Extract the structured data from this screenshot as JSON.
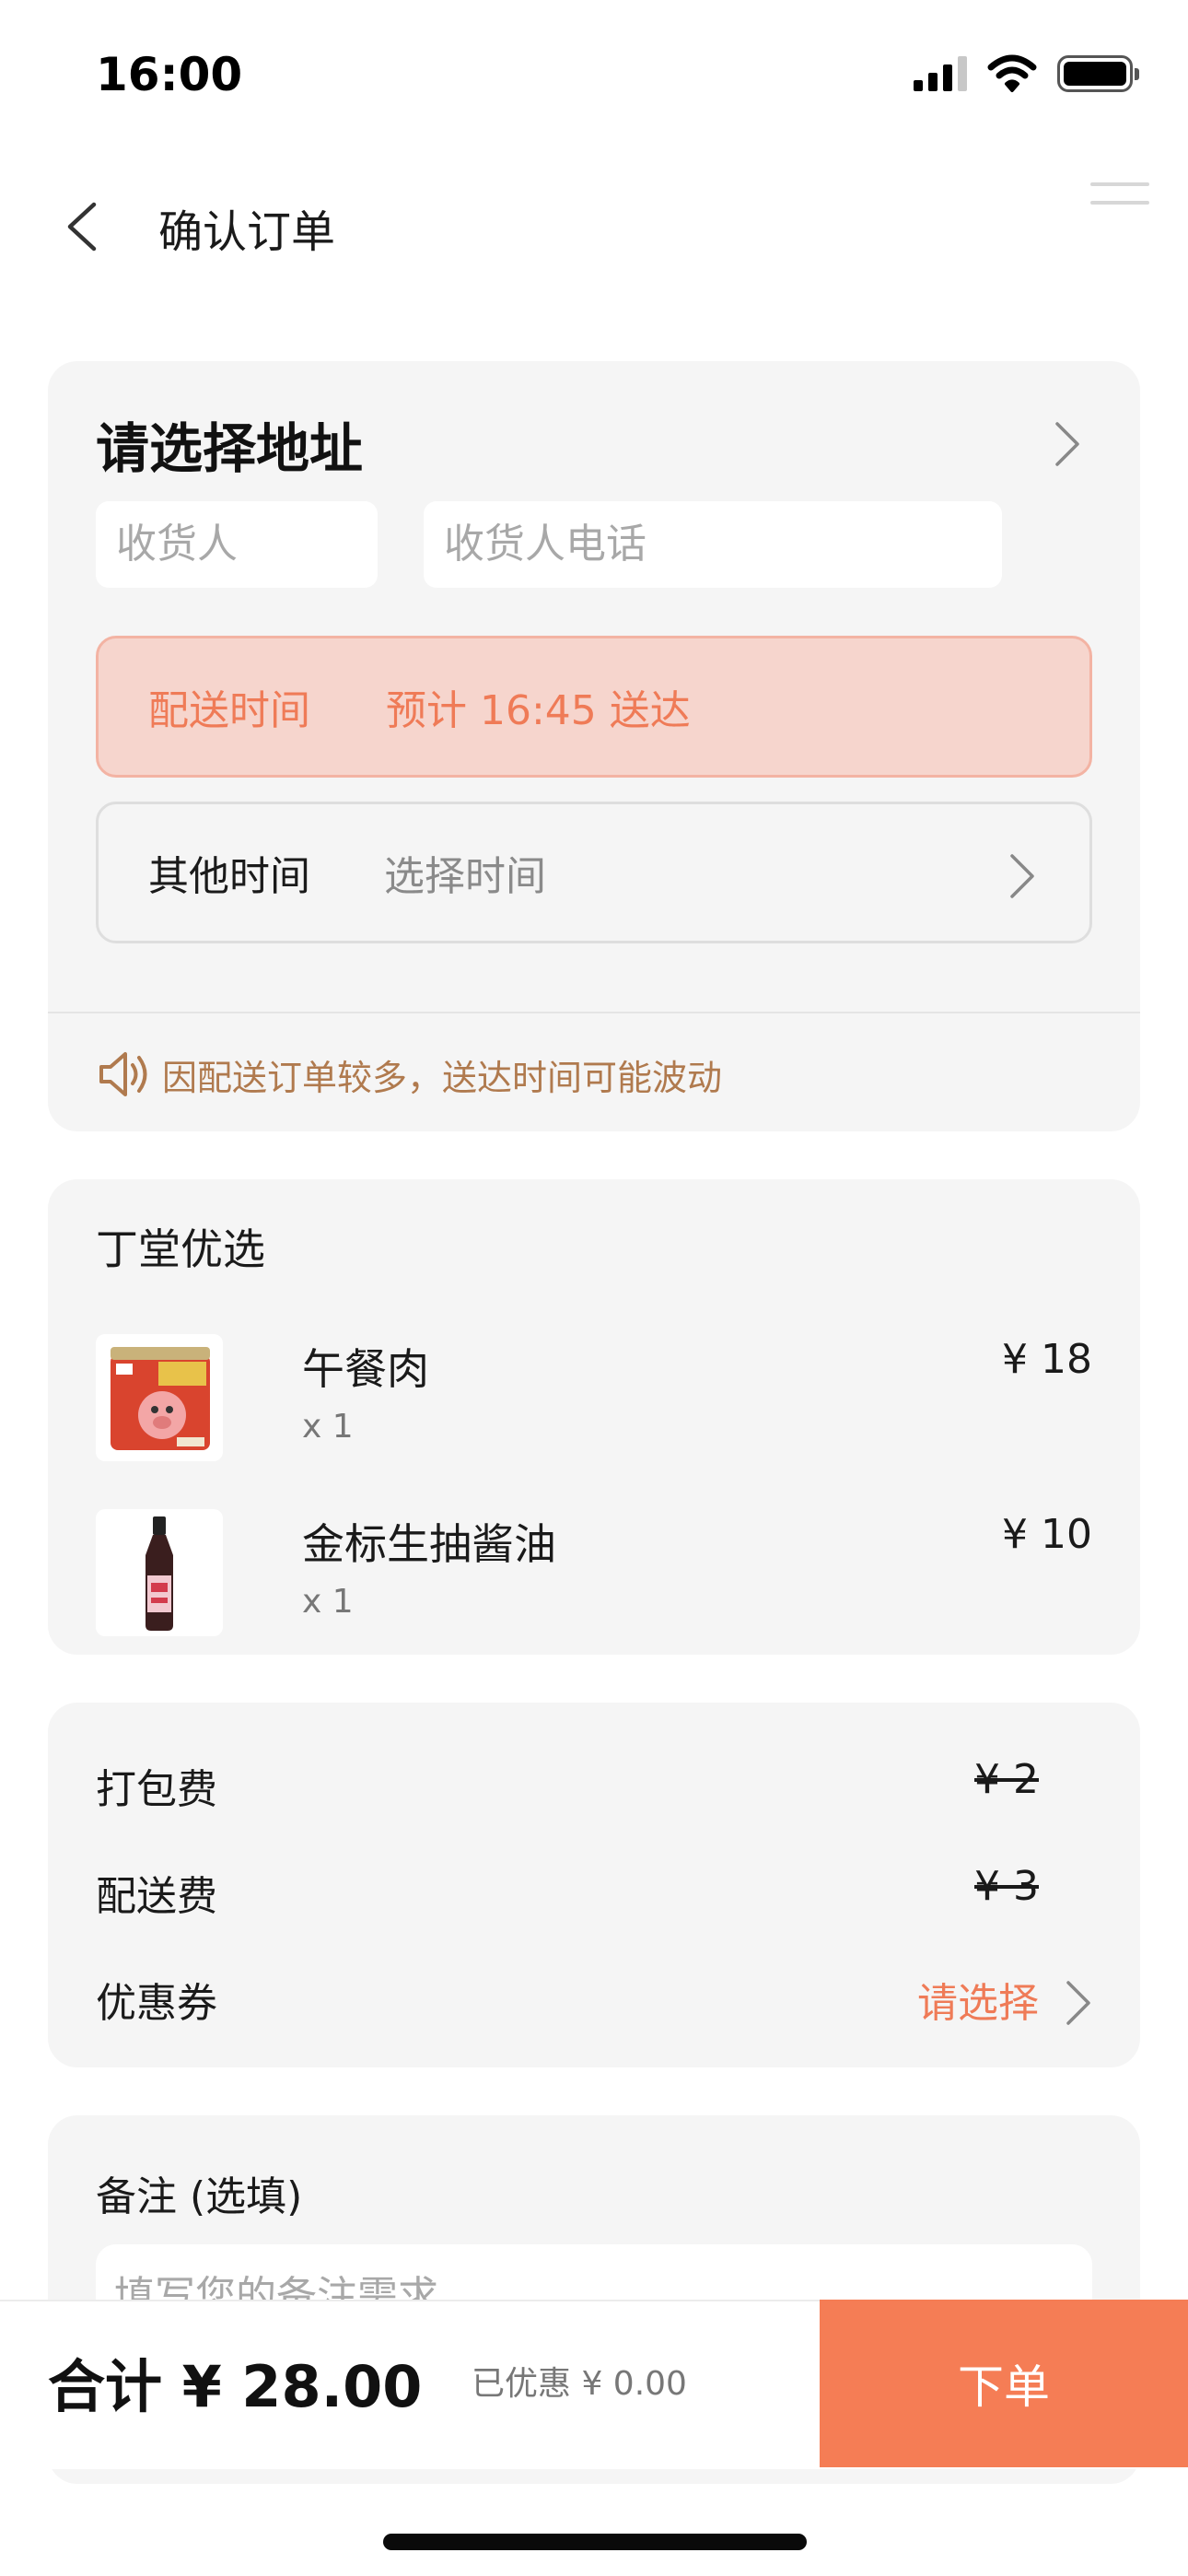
{
  "status_bar": {
    "time": "16:00"
  },
  "nav": {
    "title": "确认订单"
  },
  "address": {
    "title": "请选择地址",
    "name_placeholder": "收货人",
    "phone_placeholder": "收货人电话",
    "delivery_label": "配送时间",
    "delivery_estimate": "预计 16:45 送达",
    "other_time_label": "其他时间",
    "other_time_value": "选择时间",
    "notice": "因配送订单较多，送达时间可能波动"
  },
  "goods": {
    "shop_name": "丁堂优选",
    "items": [
      {
        "name": "午餐肉",
        "qty": "x 1",
        "price": "¥ 18"
      },
      {
        "name": "金标生抽酱油",
        "qty": "x 1",
        "price": "¥ 10"
      }
    ]
  },
  "fees": {
    "packing_label": "打包费",
    "packing_value": "¥ 2",
    "delivery_label": "配送费",
    "delivery_value": "¥ 3",
    "coupon_label": "优惠券",
    "coupon_value": "请选择"
  },
  "remark": {
    "title": "备注 (选填)",
    "placeholder": "填写您的备注需求"
  },
  "footer": {
    "total": "合计 ¥ 28.00",
    "discount": "已优惠 ¥ 0.00",
    "order_button": "下单"
  },
  "colors": {
    "accent": "#f57d55",
    "accent_text": "#ef7b57",
    "highlight_bg": "#f6d5cd",
    "notice_text": "#b07a4e",
    "card_bg": "#f5f5f5"
  }
}
